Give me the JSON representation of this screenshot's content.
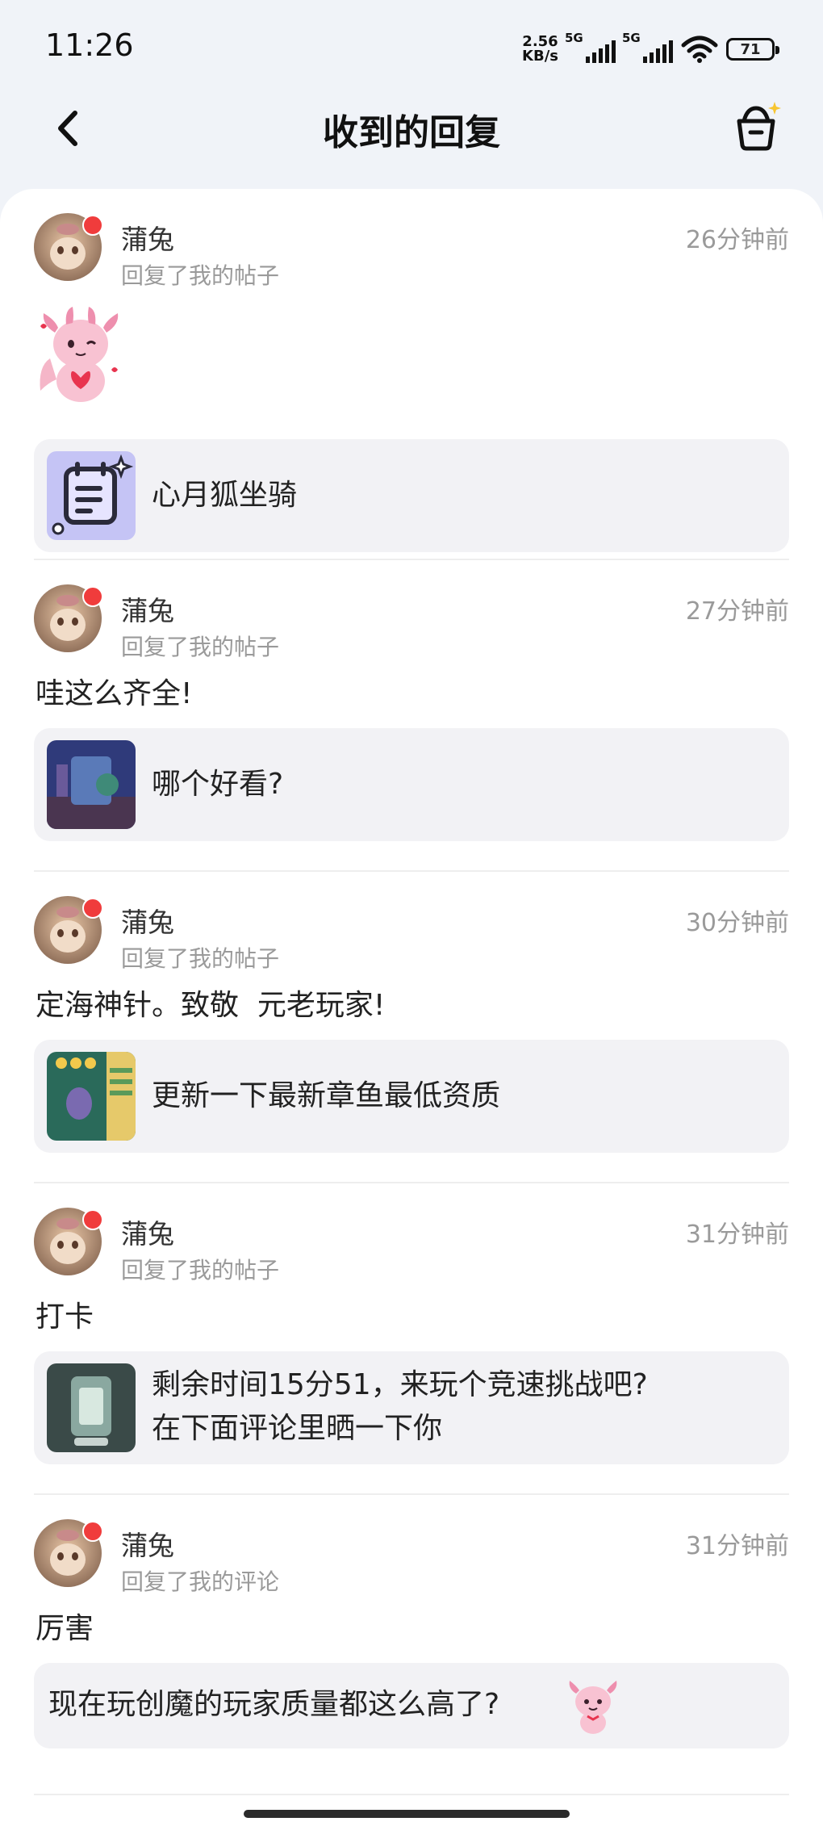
{
  "status_bar": {
    "time": "11:26",
    "net_speed_value": "2.56",
    "net_speed_unit": "KB/s",
    "signal1_label": "5G",
    "signal2_label": "5G",
    "battery": "71"
  },
  "header": {
    "title": "收到的回复",
    "back_icon": "chevron-left-icon",
    "action_icon": "basket-sparkle-icon"
  },
  "replies": [
    {
      "user": "蒲兔",
      "action": "回复了我的帖子",
      "time": "26分钟前",
      "content": "",
      "post_title": "心月狐坐骑",
      "sticker_icon": "pink-axolotl-heart-sticker",
      "thumb_icon": "notes-icon"
    },
    {
      "user": "蒲兔",
      "action": "回复了我的帖子",
      "time": "27分钟前",
      "content": "哇这么齐全!",
      "post_title": "哪个好看?"
    },
    {
      "user": "蒲兔",
      "action": "回复了我的帖子",
      "time": "30分钟前",
      "content": "定海神针。致敬  元老玩家!",
      "post_title": "更新一下最新章鱼最低资质"
    },
    {
      "user": "蒲兔",
      "action": "回复了我的帖子",
      "time": "31分钟前",
      "content": "打卡",
      "post_title_line1": "剩余时间15分51，来玩个竞速挑战吧?",
      "post_title_line2": "在下面评论里晒一下你"
    },
    {
      "user": "蒲兔",
      "action": "回复了我的评论",
      "time": "31分钟前",
      "content": "厉害",
      "comment_text": "现在玩创魔的玩家质量都这么高了?",
      "comment_sticker_icon": "pink-axolotl-sticker"
    }
  ],
  "colors": {
    "background": "#f0f3f8",
    "card": "#ffffff",
    "badge": "#f03c3c",
    "post_box": "#f2f2f5",
    "secondary_text": "#9a9a9a"
  }
}
